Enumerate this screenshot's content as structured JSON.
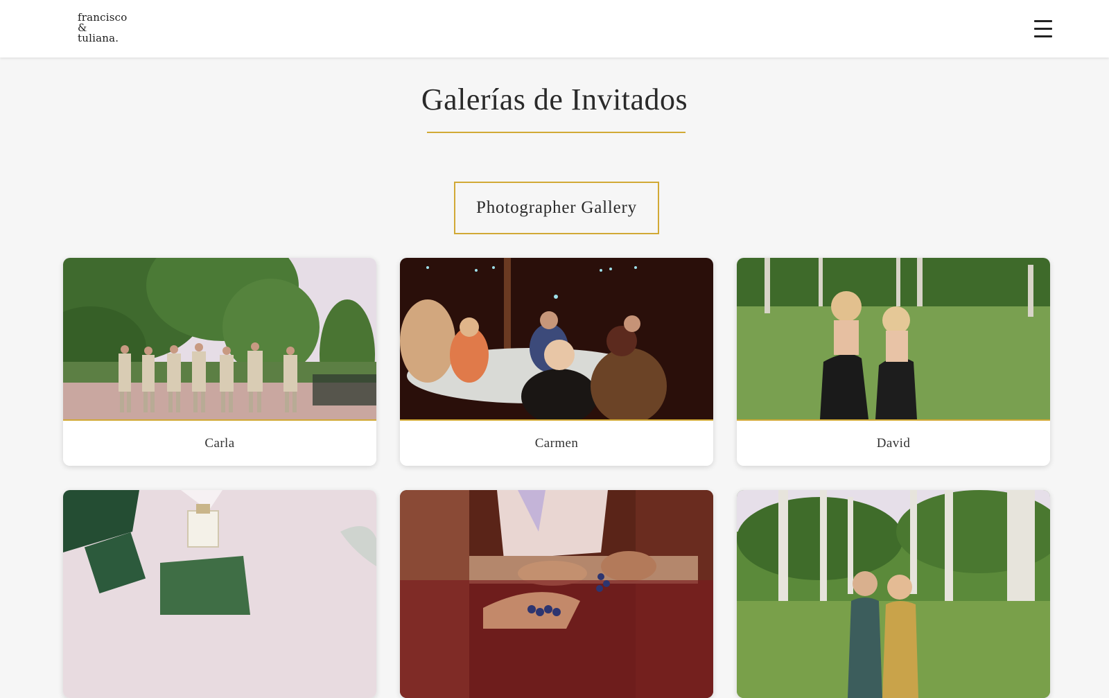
{
  "header": {
    "logo_line1": "francisco",
    "logo_line2": "&",
    "logo_line3": "tuliana.",
    "menu_icon": "hamburger-menu-icon"
  },
  "page": {
    "title": "Galerías de Invitados",
    "accent_color": "#d1a935",
    "photographer_button_label": "Photographer Gallery"
  },
  "galleries": [
    {
      "name": "Carla"
    },
    {
      "name": "Carmen"
    },
    {
      "name": "David"
    },
    {
      "name": ""
    },
    {
      "name": ""
    },
    {
      "name": ""
    }
  ]
}
